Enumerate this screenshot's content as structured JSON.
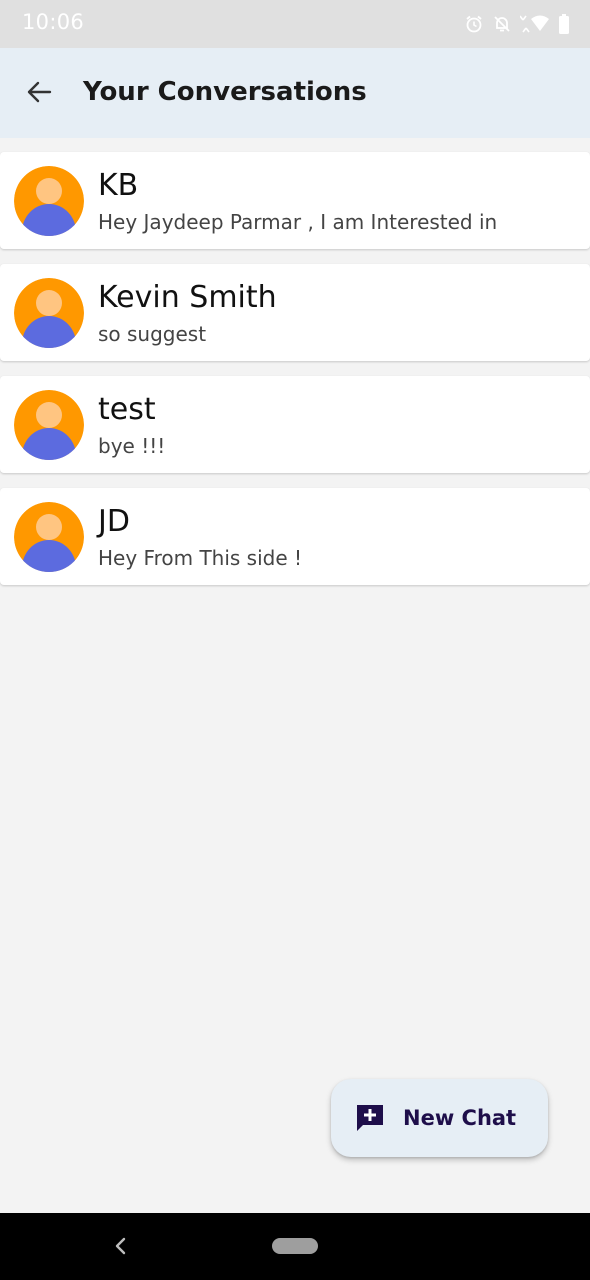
{
  "status_bar": {
    "time": "10:06",
    "icons": [
      "alarm-icon",
      "notifications-off-icon",
      "wifi-icon",
      "battery-icon"
    ]
  },
  "app_bar": {
    "back_icon": "arrow-back-icon",
    "title": "Your Conversations"
  },
  "conversations": [
    {
      "name": "KB",
      "preview": "Hey Jaydeep Parmar , I am Interested in",
      "avatar": "person-avatar-icon"
    },
    {
      "name": "Kevin Smith",
      "preview": "so suggest",
      "avatar": "person-avatar-icon"
    },
    {
      "name": "test",
      "preview": "bye !!!",
      "avatar": "person-avatar-icon"
    },
    {
      "name": "JD",
      "preview": "Hey From This side !",
      "avatar": "person-avatar-icon"
    }
  ],
  "fab": {
    "icon": "add-comment-icon",
    "label": "New Chat"
  },
  "nav_bar": {
    "back_icon": "nav-back-icon",
    "home_icon": "home-pill"
  },
  "colors": {
    "app_bar_bg": "#e6eef5",
    "page_bg": "#f3f3f3",
    "fab_text": "#1e0e4a",
    "avatar_orange": "#ff9800",
    "avatar_blue": "#5c6bdf"
  }
}
